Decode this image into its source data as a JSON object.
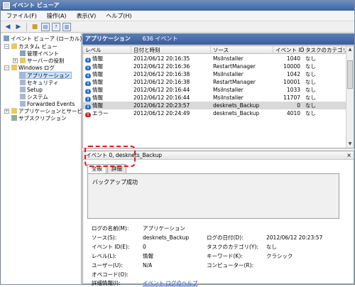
{
  "window": {
    "title": "イベント ビューア"
  },
  "menu": [
    "ファイル(F)",
    "操作(A)",
    "表示(V)",
    "ヘルプ(H)"
  ],
  "tree": {
    "root": "イベント ビューア (ローカル)",
    "custom_views": "カスタム ビュー",
    "admin_events": "管理イベント",
    "server_roles": "サーバーの役割",
    "windows_logs": "Windows ログ",
    "application": "アプリケーション",
    "security": "セキュリティ",
    "setup": "Setup",
    "system": "システム",
    "forwarded": "Forwarded Events",
    "apps_services": "アプリケーションとサービス ロ",
    "subscriptions": "サブスクリプション"
  },
  "header": {
    "title": "アプリケーション",
    "count": "636 イベント"
  },
  "grid": {
    "columns": [
      "レベル",
      "日付と時刻",
      "ソース",
      "イベント ID",
      "タスクのカテゴリ"
    ],
    "rows": [
      {
        "level": "情報",
        "date": "2012/06/12 20:16:35",
        "source": "MsiInstaller",
        "id": "1040",
        "cat": "なし",
        "type": "info"
      },
      {
        "level": "情報",
        "date": "2012/06/12 20:16:36",
        "source": "RestartManager",
        "id": "10000",
        "cat": "なし",
        "type": "info"
      },
      {
        "level": "情報",
        "date": "2012/06/12 20:16:38",
        "source": "MsiInstaller",
        "id": "1042",
        "cat": "なし",
        "type": "info"
      },
      {
        "level": "情報",
        "date": "2012/06/12 20:16:38",
        "source": "RestartManager",
        "id": "10001",
        "cat": "なし",
        "type": "info"
      },
      {
        "level": "情報",
        "date": "2012/06/12 20:16:44",
        "source": "MsiInstaller",
        "id": "1033",
        "cat": "なし",
        "type": "info"
      },
      {
        "level": "情報",
        "date": "2012/06/12 20:16:44",
        "source": "MsiInstaller",
        "id": "11707",
        "cat": "なし",
        "type": "info"
      },
      {
        "level": "情報",
        "date": "2012/06/12 20:23:57",
        "source": "desknets_Backup",
        "id": "0",
        "cat": "なし",
        "type": "info"
      },
      {
        "level": "エラー",
        "date": "2012/06/12 20:24:49",
        "source": "desknets_Backup",
        "id": "4010",
        "cat": "なし",
        "type": "err"
      }
    ]
  },
  "detail": {
    "title": "イベント 0, desknets_Backup",
    "tabs": [
      "全般",
      "詳細"
    ],
    "description": "バックアップ成功",
    "labels": {
      "log_name": "ログの名前(M):",
      "source": "ソース(S):",
      "event_id": "イベント ID(E):",
      "level": "レベル(L):",
      "user": "ユーザー(U):",
      "opcode": "オペコード(O):",
      "more_info": "詳細情報(I):",
      "logged": "ログの日付(D):",
      "task_cat": "タスクのカテゴリ(Y):",
      "keywords": "キーワード(K):",
      "computer": "コンピューター(R):"
    },
    "values": {
      "log_name": "アプリケーション",
      "source": "desknets_Backup",
      "event_id": "0",
      "level": "情報",
      "user": "N/A",
      "more_info_link": "イベント ログのヘルプ",
      "logged": "2012/06/12 20:23:57",
      "task_cat": "なし",
      "keywords": "クラシック"
    }
  }
}
